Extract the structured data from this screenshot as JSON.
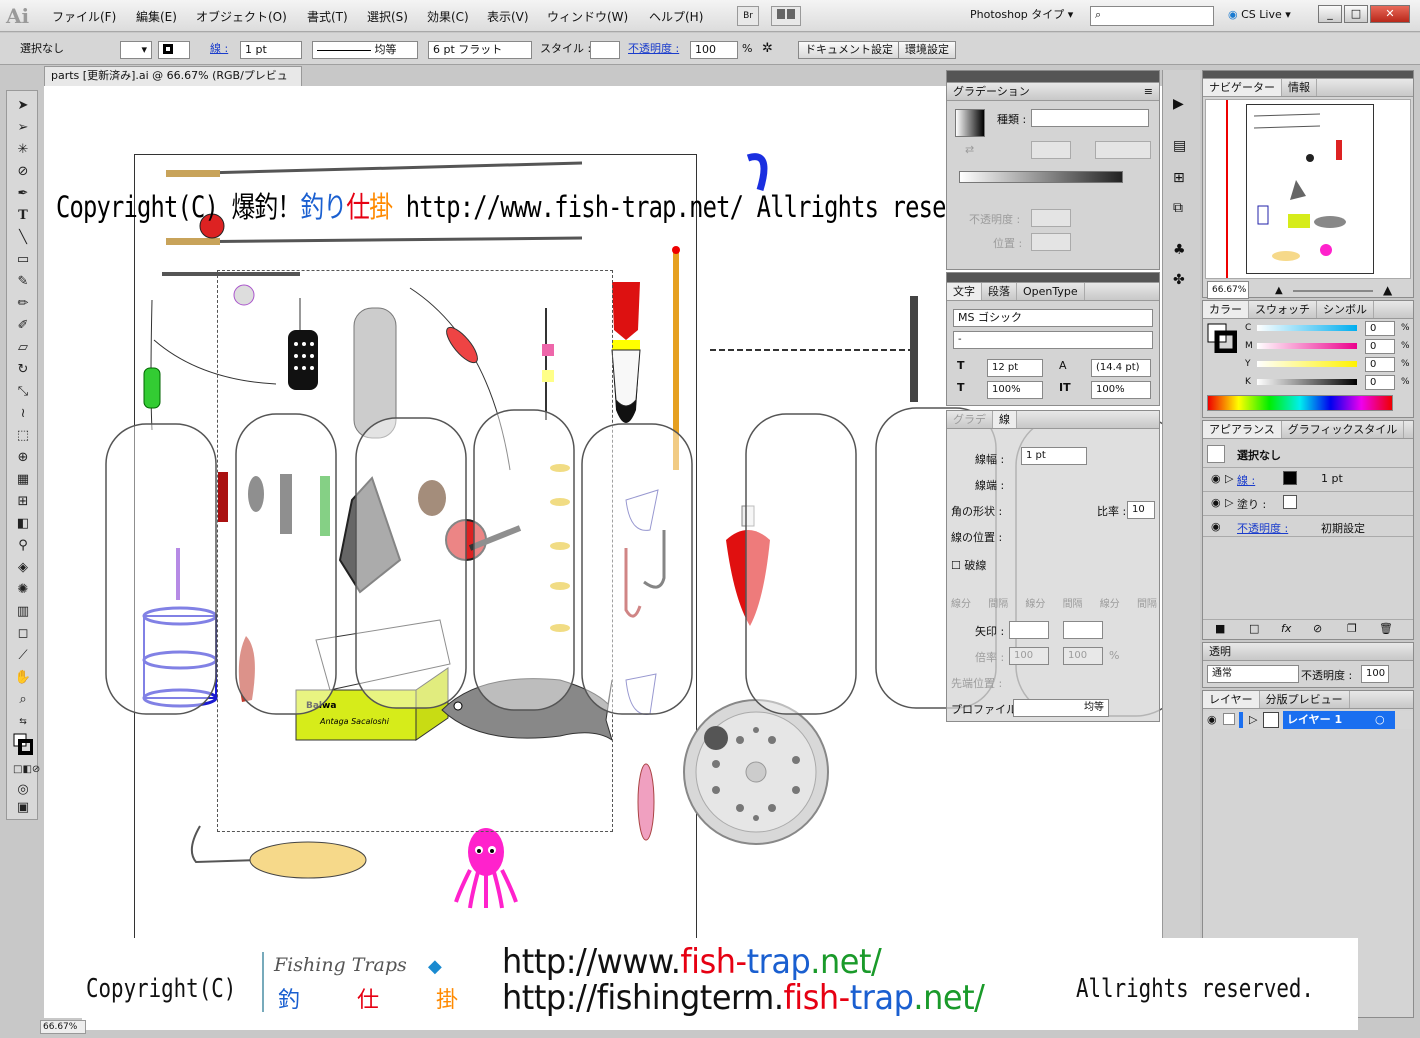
{
  "menubar": {
    "app_logo": "Ai",
    "items": [
      "ファイル(F)",
      "編集(E)",
      "オブジェクト(O)",
      "書式(T)",
      "選択(S)",
      "効果(C)",
      "表示(V)",
      "ウィンドウ(W)",
      "ヘルプ(H)"
    ],
    "bridge_label": "Br",
    "workspace": "Photoshop タイプ",
    "cs_live": "CS Live",
    "minimize": "_",
    "restore": "□",
    "close": "✕"
  },
  "controlbar": {
    "selection_state": "選択なし",
    "stroke_label": "線 :",
    "stroke_weight": "1 pt",
    "stroke_profile": "均等",
    "brush": "6 pt フラット",
    "style_label": "スタイル :",
    "opacity_label": "不透明度 :",
    "opacity_value": "100",
    "opacity_unit": "%",
    "doc_setup": "ドキュメント設定",
    "preferences": "環境設定"
  },
  "document": {
    "tab_title": "parts [更新済み].ai @ 66.67% (RGB/プレビュー)",
    "status_zoom": "66.67%"
  },
  "watermark": {
    "top_prefix": "Copyright(C) 爆釣！",
    "top_c1": "釣",
    "top_c2": "り",
    "top_c3": "仕",
    "top_c4": "掛",
    "top_suffix": " http://www.fish-trap.net/  Allrights reserved.",
    "banner_copyright": "Copyright(C)",
    "logo_en": "Fishing Traps",
    "logo_jp1": "釣",
    "logo_jp2": "仕",
    "logo_jp3": "掛",
    "url1_a": "http://www.",
    "url1_b": "fish-",
    "url1_c": "trap",
    "url1_d": ".net/",
    "url2_a": "http://fishingterm.",
    "url2_b": "fish-",
    "url2_c": "trap",
    "url2_d": ".net/",
    "banner_rights": "Allrights reserved.",
    "cooler_brand": "Balwa",
    "cooler_text": "Antaga Sacaloshi"
  },
  "gradient_panel": {
    "title": "グラデーション",
    "type_label": "種類 :",
    "opacity_label": "不透明度 :",
    "position_label": "位置 :"
  },
  "char_panel": {
    "tabs": [
      "文字",
      "段落",
      "OpenType"
    ],
    "font": "MS ゴシック",
    "style": "-",
    "size": "12 pt",
    "leading": "(14.4 pt)",
    "hscale": "100%",
    "vscale": "100%"
  },
  "stroke_panel": {
    "tab_a": "グラデ",
    "tab_b": "線",
    "weight_label": "線幅 :",
    "weight_value": "1 pt",
    "cap_label": "線端 :",
    "corner_label": "角の形状 :",
    "limit_label": "比率 :",
    "limit_value": "10",
    "align_label": "線の位置 :",
    "dashed_label": "破線",
    "dash_labels": [
      "線分",
      "間隔",
      "線分",
      "間隔",
      "線分",
      "間隔"
    ],
    "arrow_label": "矢印 :",
    "scale_label": "倍率 :",
    "scale_a": "100",
    "scale_b": "100",
    "scale_unit": "%",
    "tip_label": "先端位置 :",
    "profile_label": "プロファイル :",
    "profile_value": "均等"
  },
  "navigator_panel": {
    "tabs": [
      "ナビゲーター",
      "情報"
    ],
    "zoom": "66.67%"
  },
  "color_panel": {
    "tabs": [
      "カラー",
      "スウォッチ",
      "シンボル"
    ],
    "channels": [
      {
        "name": "C",
        "value": "0"
      },
      {
        "name": "M",
        "value": "0"
      },
      {
        "name": "Y",
        "value": "0"
      },
      {
        "name": "K",
        "value": "0"
      }
    ],
    "unit": "%"
  },
  "appearance_panel": {
    "tabs": [
      "アピアランス",
      "グラフィックスタイル"
    ],
    "title_row": "選択なし",
    "stroke_label": "線 :",
    "stroke_value": "1 pt",
    "fill_label": "塗り :",
    "opacity_label": "不透明度 :",
    "opacity_value": "初期設定"
  },
  "transparency_panel": {
    "title": "透明",
    "mode": "通常",
    "opacity_label": "不透明度 :",
    "opacity_value": "100"
  },
  "layers_panel": {
    "tabs": [
      "レイヤー",
      "分版プレビュー"
    ],
    "layer_name": "レイヤー 1"
  },
  "colors": {
    "red": "#e60012",
    "blue": "#1a5fd0",
    "orange": "#ff8a00",
    "green_text": "#1a9a2a",
    "cooler": "#d6ec1a",
    "octopus": "#ff22cc",
    "float_red": "#dd1111",
    "layer_blue": "#1a6ff0"
  }
}
